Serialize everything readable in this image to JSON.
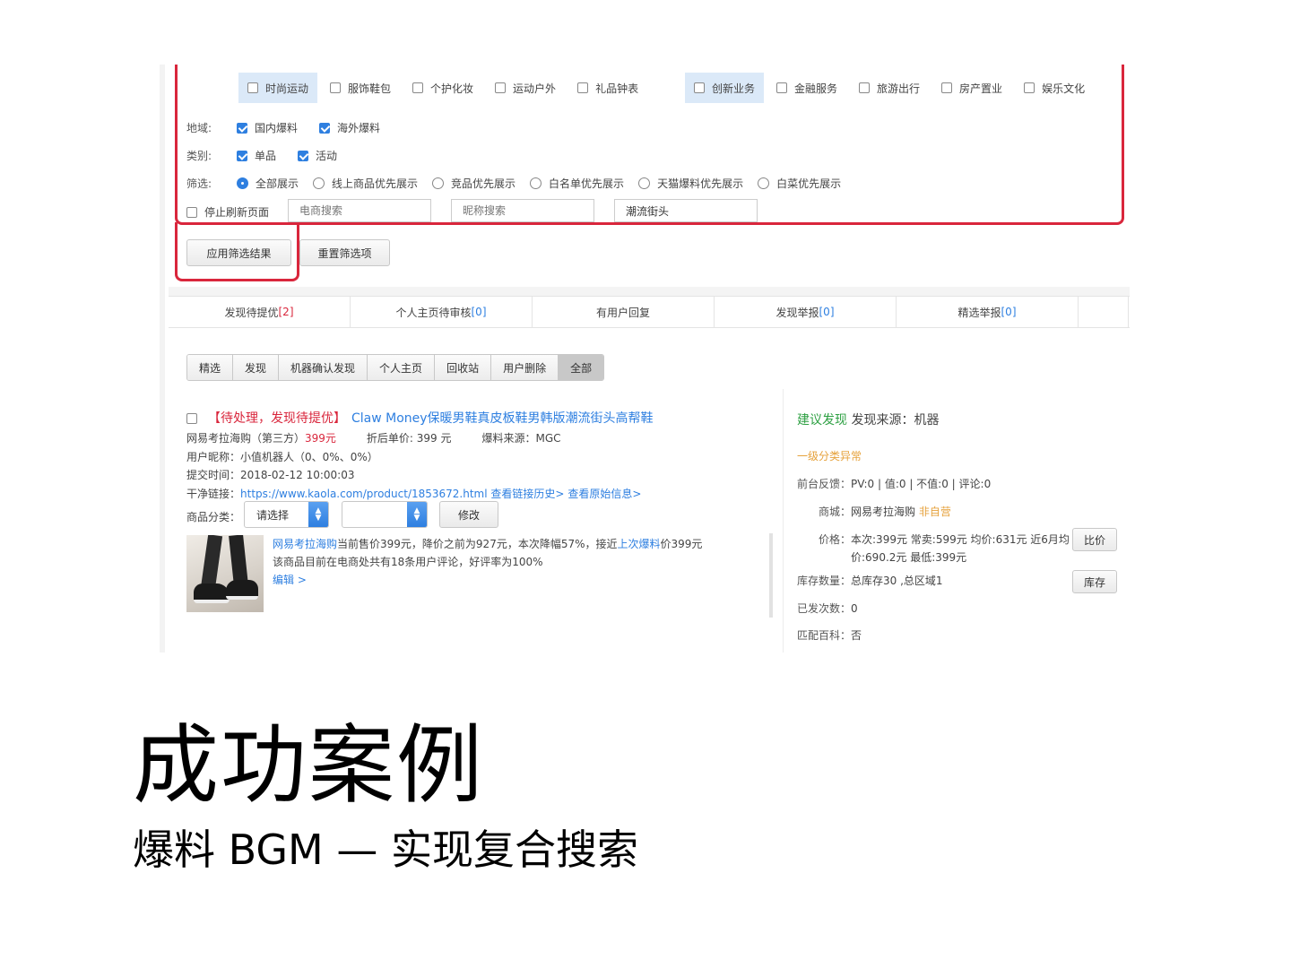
{
  "filters": {
    "categories_left": [
      {
        "label": "时尚运动",
        "highlighted": true
      },
      {
        "label": "服饰鞋包",
        "highlighted": false
      },
      {
        "label": "个护化妆",
        "highlighted": false
      },
      {
        "label": "运动户外",
        "highlighted": false
      },
      {
        "label": "礼品钟表",
        "highlighted": false
      }
    ],
    "categories_right": [
      {
        "label": "创新业务",
        "highlighted": true
      },
      {
        "label": "金融服务",
        "highlighted": false
      },
      {
        "label": "旅游出行",
        "highlighted": false
      },
      {
        "label": "房产置业",
        "highlighted": false
      },
      {
        "label": "娱乐文化",
        "highlighted": false
      }
    ],
    "region": {
      "label": "地域:",
      "options": [
        {
          "label": "国内爆料",
          "checked": true
        },
        {
          "label": "海外爆料",
          "checked": true
        }
      ]
    },
    "type": {
      "label": "类别:",
      "options": [
        {
          "label": "单品",
          "checked": true
        },
        {
          "label": "活动",
          "checked": true
        }
      ]
    },
    "sort": {
      "label": "筛选:",
      "options": [
        {
          "label": "全部展示",
          "selected": true
        },
        {
          "label": "线上商品优先展示",
          "selected": false
        },
        {
          "label": "竞品优先展示",
          "selected": false
        },
        {
          "label": "白名单优先展示",
          "selected": false
        },
        {
          "label": "天猫爆料优先展示",
          "selected": false
        },
        {
          "label": "白菜优先展示",
          "selected": false
        }
      ]
    },
    "stop_refresh": "停止刷新页面",
    "merchant_search_placeholder": "电商搜索",
    "nickname_search_placeholder": "昵称搜索",
    "keyword_value": "潮流街头",
    "apply_button": "应用筛选结果",
    "reset_button": "重置筛选项"
  },
  "tabs": [
    {
      "label": "发现待提优",
      "count": "[2]",
      "count_color": "red"
    },
    {
      "label": "个人主页待审核",
      "count": "[0]",
      "count_color": "blue"
    },
    {
      "label": "有用户回复",
      "count": "",
      "count_color": "blue"
    },
    {
      "label": "发现举报",
      "count": "[0]",
      "count_color": "blue"
    },
    {
      "label": "精选举报",
      "count": "[0]",
      "count_color": "blue"
    }
  ],
  "segments": [
    {
      "label": "精选",
      "active": false
    },
    {
      "label": "发现",
      "active": false
    },
    {
      "label": "机器确认发现",
      "active": false
    },
    {
      "label": "个人主页",
      "active": false
    },
    {
      "label": "回收站",
      "active": false
    },
    {
      "label": "用户删除",
      "active": false
    },
    {
      "label": "全部",
      "active": true
    }
  ],
  "item": {
    "status": "【待处理，发现待提优】",
    "title": "Claw Money保暖男鞋真皮板鞋男韩版潮流街头高帮鞋",
    "merchant": "网易考拉海购（第三方）",
    "price": "399元",
    "discount_price": "折后单价: 399 元",
    "source": "爆料来源：MGC",
    "user_label": "用户昵称：",
    "user_value": "小值机器人（0、0%、0%）",
    "submit_label": "提交时间：",
    "submit_value": "2018-02-12 10:00:03",
    "link_label": "干净链接：",
    "link_url": "https://www.kaola.com/product/1853672.html",
    "link_history": "查看链接历史>",
    "link_origin": "查看原始信息>",
    "category_label": "商品分类：",
    "category_select": "请选择",
    "modify_button": "修改",
    "desc_merchant": "网易考拉海购",
    "desc_1": "当前售价399元，降价之前为927元，本次降幅57%，接近",
    "desc_link": "上次爆料",
    "desc_2": "价399元",
    "desc_3": "该商品目前在电商处共有18条用户评论，好评率为100%",
    "edit_link": "编辑 >"
  },
  "right": {
    "suggest": "建议发现",
    "source": "发现来源：机器",
    "warning": "一级分类异常",
    "feedback_label": "前台反馈：",
    "feedback_value": "PV:0 | 值:0 | 不值:0 | 评论:0",
    "mall_label": "商城：",
    "mall_value": "网易考拉海购",
    "mall_tag": "非自营",
    "price_label": "价格：",
    "price_line1": "本次:399元 常卖:599元 均价:631元 近6月均",
    "price_line2": "价:690.2元 最低:399元",
    "compare_button": "比价",
    "stock_label": "库存数量：",
    "stock_value": "总库存30 ,总区域1",
    "stock_button": "库存",
    "sent_label": "已发次数：",
    "sent_value": "0",
    "wiki_label": "匹配百科：",
    "wiki_value": "否"
  },
  "caption": {
    "title": "成功案例",
    "subtitle": "爆料 BGM —  实现复合搜索"
  }
}
